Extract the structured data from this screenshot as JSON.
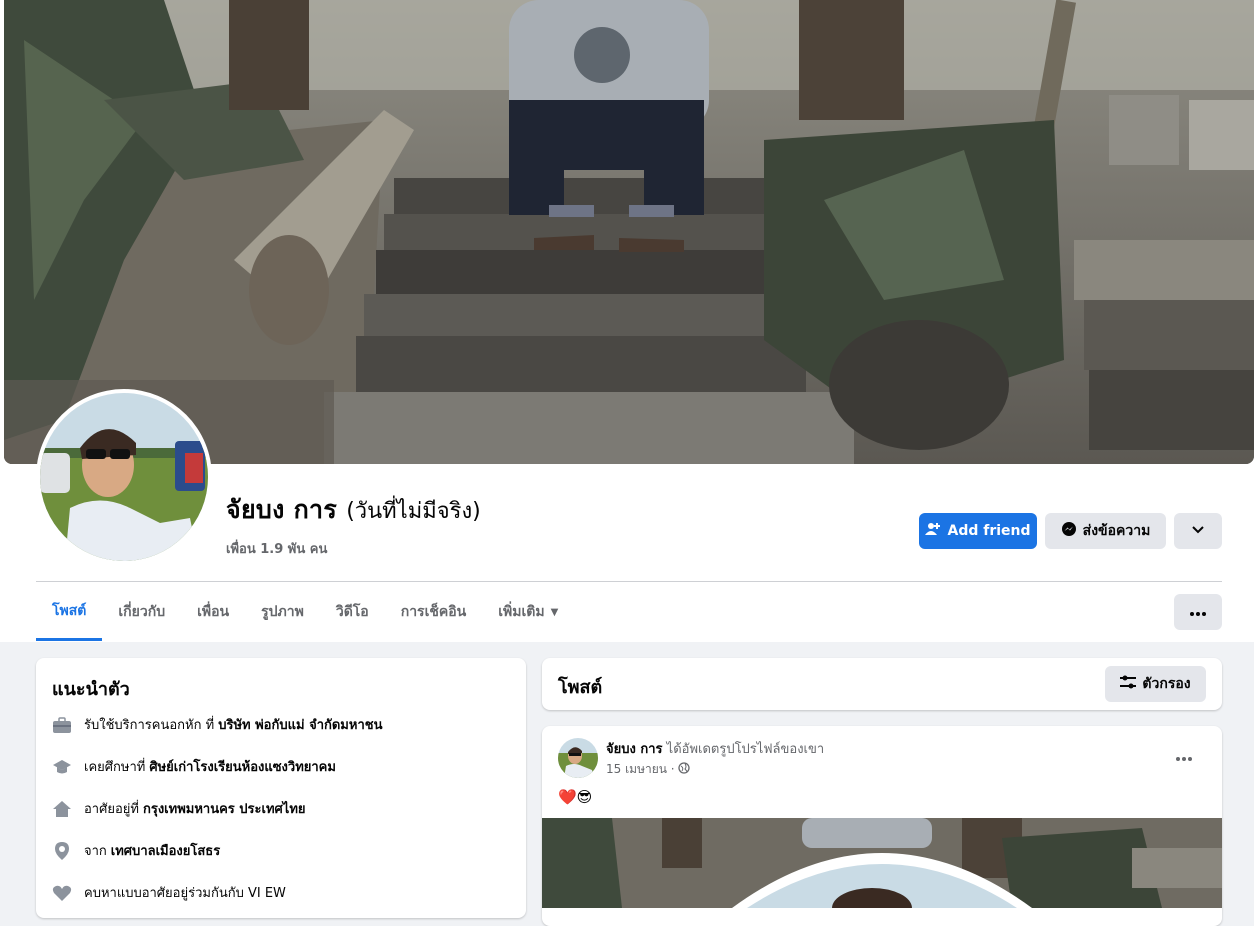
{
  "profile": {
    "name": "จัยบง การ",
    "alternate_name": "(วันที่ไม่มีจริง)",
    "friends_count": "เพื่อน 1.9 พัน คน"
  },
  "actions": {
    "add_friend": "Add friend",
    "message": "ส่งข้อความ"
  },
  "tabs": [
    {
      "label": "โพสต์",
      "active": true
    },
    {
      "label": "เกี่ยวกับ"
    },
    {
      "label": "เพื่อน"
    },
    {
      "label": "รูปภาพ"
    },
    {
      "label": "วิดีโอ"
    },
    {
      "label": "การเช็คอิน"
    },
    {
      "label": "เพิ่มเติม"
    }
  ],
  "intro": {
    "title": "แนะนำตัว",
    "items": [
      {
        "icon": "briefcase-icon",
        "text": "รับใช้บริการคนอกหัก ที่",
        "bold": "บริษัท พ่อกับแม่ จำกัดมหาชน"
      },
      {
        "icon": "graduation-cap-icon",
        "text": "เคยศึกษาที่",
        "bold": "ศิษย์เก่าโรงเรียนห้องแซงวิทยาคม"
      },
      {
        "icon": "home-icon",
        "text": "อาศัยอยู่ที่",
        "bold": "กรุงเทพมหานคร ประเทศไทย"
      },
      {
        "icon": "location-pin-icon",
        "text": "จาก",
        "bold": "เทศบาลเมืองยโสธร"
      },
      {
        "icon": "heart-icon",
        "text": "คบหาแบบอาศัยอยู่ร่วมกันกับ VI EW",
        "bold": ""
      }
    ]
  },
  "posts": {
    "title": "โพสต์",
    "filter_label": "ตัวกรอง",
    "post": {
      "author": "จัยบง การ",
      "action": "ได้อัพเดตรูปโปรไฟล์ของเขา",
      "date": "15 เมษายน ·",
      "emoji": "❤️😎"
    }
  },
  "colors": {
    "accent": "#1b74e4",
    "page_bg": "#f0f2f5",
    "secondary_text": "#65676b"
  }
}
